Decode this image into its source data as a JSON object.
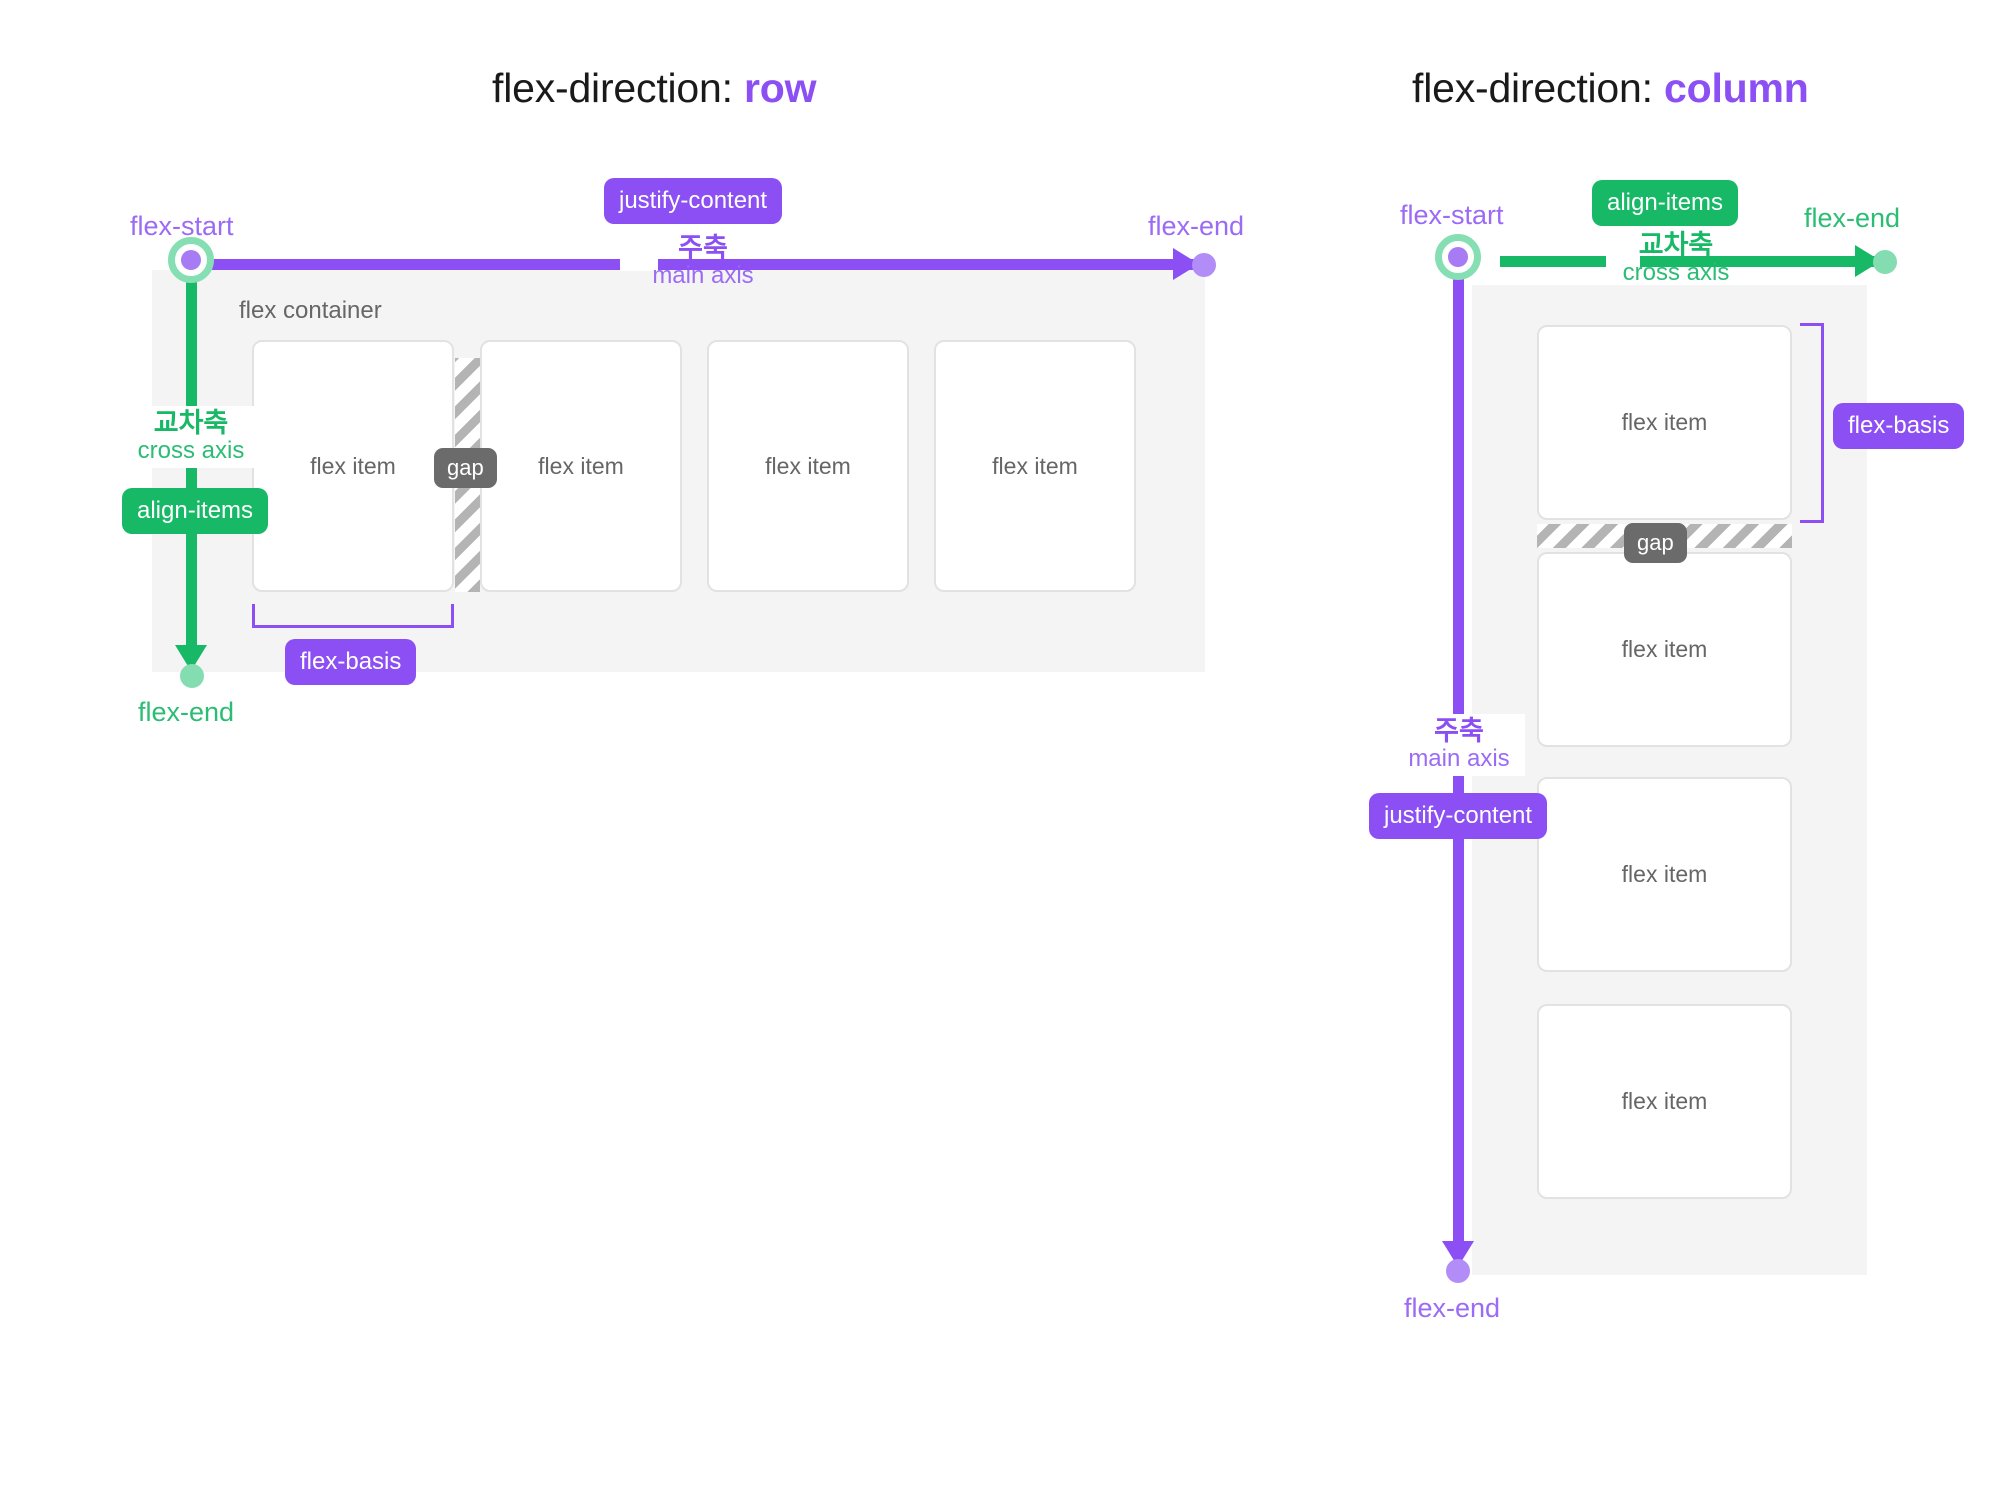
{
  "page": {
    "background": "#ffffff",
    "accent_purple": "#8b4ff3",
    "accent_green": "#17b866",
    "container_bg": "#f4f4f4",
    "item_border": "#e2e2e2",
    "gap_pill_bg": "#6b6b6b"
  },
  "row_diagram": {
    "title_prefix": "flex-direction: ",
    "title_value": "row",
    "container_label": "flex container",
    "items": [
      {
        "label": "flex item"
      },
      {
        "label": "flex item"
      },
      {
        "label": "flex item"
      },
      {
        "label": "flex item"
      }
    ],
    "gap_label": "gap",
    "main_axis": {
      "ko": "주축",
      "en": "main axis",
      "property_pill": "justify-content",
      "start_label": "flex-start",
      "end_label": "flex-end",
      "color": "#8b4ff3"
    },
    "cross_axis": {
      "ko": "교차축",
      "en": "cross axis",
      "property_pill": "align-items",
      "end_label": "flex-end",
      "color": "#17b866"
    },
    "flex_basis_label": "flex-basis"
  },
  "column_diagram": {
    "title_prefix": "flex-direction: ",
    "title_value": "column",
    "items": [
      {
        "label": "flex item"
      },
      {
        "label": "flex item"
      },
      {
        "label": "flex item"
      },
      {
        "label": "flex item"
      }
    ],
    "gap_label": "gap",
    "main_axis": {
      "ko": "주축",
      "en": "main axis",
      "property_pill": "justify-content",
      "start_label": "flex-start",
      "end_label": "flex-end",
      "color": "#8b4ff3"
    },
    "cross_axis": {
      "ko": "교차축",
      "en": "cross axis",
      "property_pill": "align-items",
      "end_label": "flex-end",
      "color": "#17b866"
    },
    "flex_basis_label": "flex-basis"
  }
}
